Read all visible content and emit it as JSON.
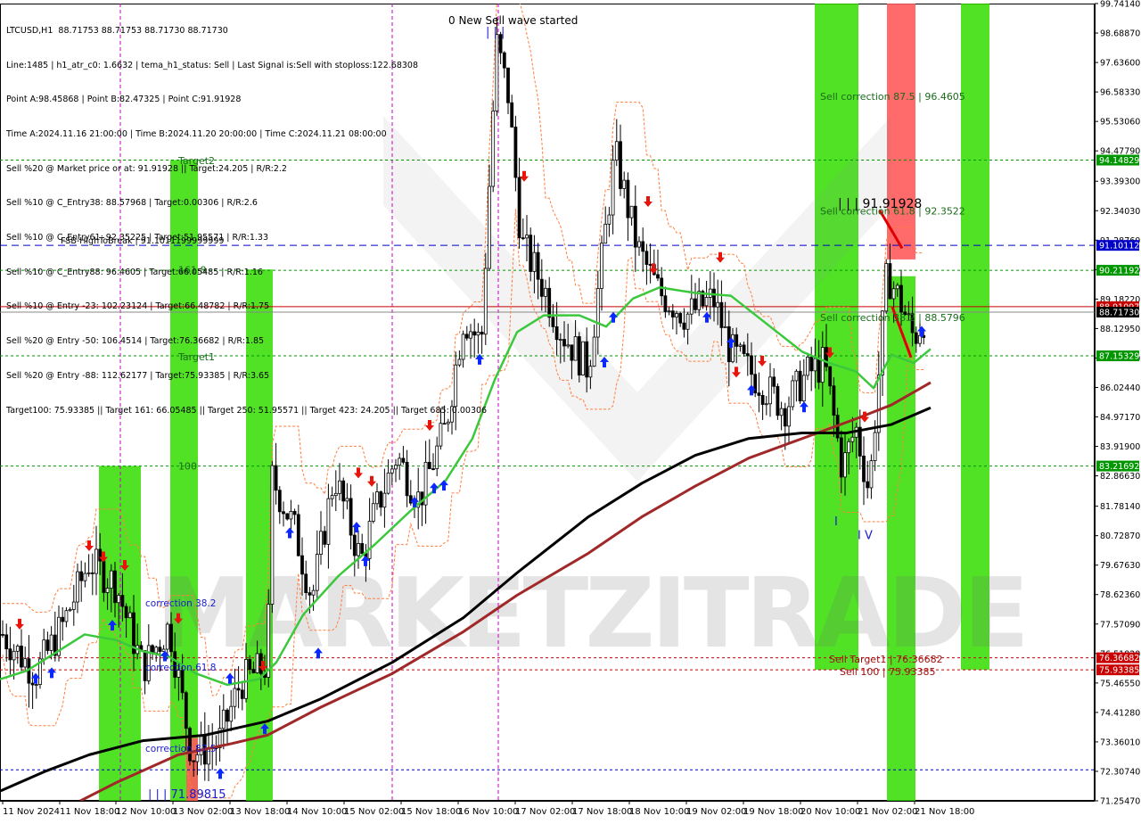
{
  "window_title": "LTCUSD,H1  88.71753 88.71753 88.71730 88.71730",
  "info_lines": [
    "Line:1485 | h1_atr_c0: 1.6632 | tema_h1_status: Sell | Last Signal is:Sell with stoploss:122.68308",
    "Point A:98.45868 | Point B:82.47325 | Point C:91.91928",
    "Time A:2024.11.16 21:00:00 | Time B:2024.11.20 20:00:00 | Time C:2024.11.21 08:00:00",
    "Sell %20 @ Market price or at: 91.91928 || Target:24.205 | R/R:2.2",
    "Sell %10 @ C_Entry38: 88.57968 | Target:0.00306 | R/R:2.6",
    "Sell %10 @ C_Entry61: 92.35225 | Target:51.95571 | R/R:1.33",
    "Sell %10 @ C_Entry88: 96.4605 | Target:66.05485 | R/R:1.16",
    "Sell %10 @ Entry -23: 102.23124 | Target:66.48782 | R/R:1.75",
    "Sell %20 @ Entry -50: 106.4514 | Target:76.36682 | R/R:1.85",
    "Sell %20 @ Entry -88: 112.62177 | Target:75.93385 | R/R:3.65",
    "Target100: 75.93385 || Target 161: 66.05485 || Target 250: 51.95571 || Target 423: 24.205 || Target 685: 0.00306"
  ],
  "top_message": "0 New Sell wave started",
  "watermark": "MARKETZITRADE",
  "colors": {
    "background": "#ffffff",
    "bull_candle": "#000000",
    "bear_candle": "#000000",
    "sma_fast": "#3cc83c",
    "sma_mid": "#a02828",
    "sma_slow": "#000000",
    "green_zone": "#33dd00",
    "red_zone": "#ff5a5a",
    "buy_arrow": "#0a28ff",
    "sell_arrow": "#e6140a",
    "level_green": "#009600",
    "level_blue": "#0000c8",
    "level_red": "#c80000",
    "envelope": "#ff7f3f",
    "zone_label": "#0a4a0a"
  },
  "chart_data": {
    "type": "candlestick",
    "symbol": "LTCUSD",
    "timeframe": "H1",
    "ylim": [
      71.2547,
      99.7414
    ],
    "y_ticks": [
      "99.74140",
      "98.68870",
      "97.63600",
      "96.58330",
      "95.53060",
      "94.47790",
      "93.39300",
      "92.34030",
      "91.28760",
      "90.23490",
      "89.18220",
      "88.12950",
      "87.07680",
      "86.02440",
      "84.97170",
      "83.91900",
      "82.86630",
      "81.78140",
      "80.72870",
      "79.67630",
      "78.62360",
      "77.57090",
      "76.51820",
      "75.46550",
      "74.41280",
      "73.36010",
      "72.30740",
      "71.25470"
    ],
    "x_ticks": [
      "11 Nov 2024",
      "11 Nov 18:00",
      "12 Nov 10:00",
      "13 Nov 02:00",
      "13 Nov 18:00",
      "14 Nov 10:00",
      "15 Nov 02:00",
      "15 Nov 18:00",
      "16 Nov 10:00",
      "17 Nov 02:00",
      "17 Nov 18:00",
      "18 Nov 10:00",
      "19 Nov 02:00",
      "19 Nov 18:00",
      "20 Nov 10:00",
      "21 Nov 02:00",
      "21 Nov 18:00"
    ],
    "price_badges": [
      {
        "label": "94.14829",
        "value": 94.14829,
        "color": "#009600"
      },
      {
        "label": "91.10112",
        "value": 91.10112,
        "color": "#0000c8"
      },
      {
        "label": "90.21192",
        "value": 90.21192,
        "color": "#009600"
      },
      {
        "label": "88.91097",
        "value": 88.91097,
        "color": "#c80000"
      },
      {
        "label": "88.71730",
        "value": 88.7173,
        "color": "#000000"
      },
      {
        "label": "87.15329",
        "value": 87.15329,
        "color": "#009600"
      },
      {
        "label": "83.21692",
        "value": 83.21692,
        "color": "#009600"
      },
      {
        "label": "76.36682",
        "value": 76.36682,
        "color": "#c80000"
      },
      {
        "label": "75.93385",
        "value": 75.93385,
        "color": "#c80000"
      }
    ],
    "levels": [
      {
        "value": 94.14829,
        "style": "dotted",
        "color": "#009600"
      },
      {
        "value": 91.10112,
        "style": "dashed",
        "color": "#0000c8",
        "label": "FSB-HighToBreak | 91.1011199999999"
      },
      {
        "value": 90.21192,
        "style": "dotted",
        "color": "#009600"
      },
      {
        "value": 88.91097,
        "style": "solid",
        "color": "#c80000"
      },
      {
        "value": 88.7173,
        "style": "solid",
        "color": "#888888"
      },
      {
        "value": 87.15329,
        "style": "dotted",
        "color": "#009600"
      },
      {
        "value": 83.21692,
        "style": "dotted",
        "color": "#009600"
      },
      {
        "value": 76.36682,
        "style": "dotted",
        "color": "#c80000"
      },
      {
        "value": 75.93385,
        "style": "dotted",
        "color": "#c80000"
      },
      {
        "value": 72.36,
        "style": "dotted",
        "color": "#0000c8"
      }
    ],
    "zone_labels": [
      {
        "text": "Target2",
        "value": 94.0,
        "bar": 200
      },
      {
        "text": "161.8",
        "value": 90.1,
        "bar": 200
      },
      {
        "text": "Target1",
        "value": 87.0,
        "bar": 200
      },
      {
        "text": "100",
        "value": 83.1,
        "bar": 200
      },
      {
        "text": "Sell correction 87.5 | 96.4605",
        "value": 96.3,
        "bar": 920
      },
      {
        "text": "Sell correction 61.8 | 92.3522",
        "value": 92.2,
        "bar": 920
      },
      {
        "text": "Sell correction 38.2 | 88.5796",
        "value": 88.4,
        "bar": 920
      },
      {
        "text": "Sell Target1 | 76.36682",
        "value": 76.2,
        "bar": 930
      },
      {
        "text": "Sell 100 | 75.93385",
        "value": 75.75,
        "bar": 942
      }
    ],
    "blue_labels": [
      {
        "text": "correction 38.2",
        "value": 78.2,
        "bar": 163
      },
      {
        "text": "correction 61.8",
        "value": 75.9,
        "bar": 163
      },
      {
        "text": "correction 87.5",
        "value": 73.0,
        "bar": 163
      },
      {
        "text": "| | | 71.89815",
        "value": 71.35,
        "bar": 166
      }
    ],
    "wave_labels": [
      {
        "text": "| | |",
        "value": 98.6,
        "bar": 545
      },
      {
        "text": "| | | 91.91928",
        "value": 92.45,
        "bar": 940
      },
      {
        "text": "I V",
        "value": 80.6,
        "bar": 962
      },
      {
        "text": "I",
        "value": 81.1,
        "bar": 936
      }
    ],
    "green_zones": [
      {
        "x0": 111,
        "x1": 158,
        "top": 83.22,
        "bottom": 71.25
      },
      {
        "x0": 191,
        "x1": 222,
        "top": 94.15,
        "bottom": 71.25
      },
      {
        "x0": 276,
        "x1": 306,
        "top": 90.24,
        "bottom": 71.25
      },
      {
        "x0": 914,
        "x1": 963,
        "top": 99.74,
        "bottom": 75.94
      },
      {
        "x0": 995,
        "x1": 1027,
        "top": 90.0,
        "bottom": 71.25
      },
      {
        "x0": 1078,
        "x1": 1110,
        "top": 99.74,
        "bottom": 75.94
      }
    ],
    "red_zones": [
      {
        "x0": 209,
        "x1": 222,
        "top": 73.5,
        "bottom": 71.25
      },
      {
        "x0": 995,
        "x1": 1027,
        "top": 99.74,
        "bottom": 90.6
      }
    ],
    "vlines": [
      135,
      440,
      559
    ],
    "anchor_points": [
      {
        "x": 3,
        "y": 77.2
      },
      {
        "x": 40,
        "y": 75.8
      },
      {
        "x": 70,
        "y": 77.5
      },
      {
        "x": 100,
        "y": 79.8
      },
      {
        "x": 130,
        "y": 79.0
      },
      {
        "x": 160,
        "y": 76.0
      },
      {
        "x": 190,
        "y": 77.5
      },
      {
        "x": 215,
        "y": 72.9
      },
      {
        "x": 245,
        "y": 73.3
      },
      {
        "x": 270,
        "y": 75.5
      },
      {
        "x": 300,
        "y": 76.1
      },
      {
        "x": 305,
        "y": 82.8
      },
      {
        "x": 330,
        "y": 81.0
      },
      {
        "x": 350,
        "y": 78.5
      },
      {
        "x": 375,
        "y": 82.9
      },
      {
        "x": 405,
        "y": 79.8
      },
      {
        "x": 420,
        "y": 81.5
      },
      {
        "x": 445,
        "y": 83.6
      },
      {
        "x": 470,
        "y": 82.0
      },
      {
        "x": 500,
        "y": 84.6
      },
      {
        "x": 520,
        "y": 88.5
      },
      {
        "x": 540,
        "y": 87.6
      },
      {
        "x": 557,
        "y": 98.3
      },
      {
        "x": 570,
        "y": 96.5
      },
      {
        "x": 585,
        "y": 91.2
      },
      {
        "x": 610,
        "y": 89.6
      },
      {
        "x": 630,
        "y": 88.0
      },
      {
        "x": 660,
        "y": 86.7
      },
      {
        "x": 690,
        "y": 94.4
      },
      {
        "x": 715,
        "y": 91.0
      },
      {
        "x": 740,
        "y": 89.4
      },
      {
        "x": 770,
        "y": 88.6
      },
      {
        "x": 800,
        "y": 89.2
      },
      {
        "x": 820,
        "y": 87.3
      },
      {
        "x": 850,
        "y": 86.3
      },
      {
        "x": 880,
        "y": 85.3
      },
      {
        "x": 905,
        "y": 86.5
      },
      {
        "x": 925,
        "y": 86.9
      },
      {
        "x": 945,
        "y": 83.1
      },
      {
        "x": 960,
        "y": 84.6
      },
      {
        "x": 975,
        "y": 82.3
      },
      {
        "x": 995,
        "y": 90.1
      },
      {
        "x": 1010,
        "y": 89.1
      },
      {
        "x": 1025,
        "y": 87.8
      },
      {
        "x": 1040,
        "y": 88.7
      }
    ],
    "ma_fast": [
      {
        "x": 0,
        "y": 75.6
      },
      {
        "x": 30,
        "y": 75.9
      },
      {
        "x": 60,
        "y": 76.5
      },
      {
        "x": 95,
        "y": 77.2
      },
      {
        "x": 130,
        "y": 77.0
      },
      {
        "x": 160,
        "y": 76.6
      },
      {
        "x": 190,
        "y": 76.4
      },
      {
        "x": 220,
        "y": 75.8
      },
      {
        "x": 255,
        "y": 75.4
      },
      {
        "x": 290,
        "y": 75.6
      },
      {
        "x": 310,
        "y": 76.2
      },
      {
        "x": 340,
        "y": 77.9
      },
      {
        "x": 380,
        "y": 79.3
      },
      {
        "x": 420,
        "y": 80.4
      },
      {
        "x": 460,
        "y": 81.6
      },
      {
        "x": 500,
        "y": 82.7
      },
      {
        "x": 530,
        "y": 84.2
      },
      {
        "x": 555,
        "y": 86.3
      },
      {
        "x": 580,
        "y": 88.0
      },
      {
        "x": 610,
        "y": 88.6
      },
      {
        "x": 650,
        "y": 88.6
      },
      {
        "x": 680,
        "y": 88.2
      },
      {
        "x": 710,
        "y": 89.2
      },
      {
        "x": 740,
        "y": 89.6
      },
      {
        "x": 780,
        "y": 89.4
      },
      {
        "x": 820,
        "y": 89.3
      },
      {
        "x": 860,
        "y": 88.3
      },
      {
        "x": 900,
        "y": 87.3
      },
      {
        "x": 930,
        "y": 86.9
      },
      {
        "x": 960,
        "y": 86.6
      },
      {
        "x": 980,
        "y": 86.0
      },
      {
        "x": 1000,
        "y": 87.2
      },
      {
        "x": 1025,
        "y": 86.9
      },
      {
        "x": 1044,
        "y": 87.4
      }
    ],
    "ma_mid": [
      {
        "x": 90,
        "y": 71.25
      },
      {
        "x": 130,
        "y": 71.9
      },
      {
        "x": 200,
        "y": 72.9
      },
      {
        "x": 260,
        "y": 73.3
      },
      {
        "x": 300,
        "y": 73.6
      },
      {
        "x": 360,
        "y": 74.6
      },
      {
        "x": 440,
        "y": 75.8
      },
      {
        "x": 520,
        "y": 77.3
      },
      {
        "x": 580,
        "y": 78.6
      },
      {
        "x": 660,
        "y": 80.1
      },
      {
        "x": 720,
        "y": 81.4
      },
      {
        "x": 780,
        "y": 82.5
      },
      {
        "x": 840,
        "y": 83.5
      },
      {
        "x": 900,
        "y": 84.2
      },
      {
        "x": 960,
        "y": 84.9
      },
      {
        "x": 1000,
        "y": 85.4
      },
      {
        "x": 1044,
        "y": 86.2
      }
    ],
    "ma_slow": [
      {
        "x": 0,
        "y": 71.6
      },
      {
        "x": 50,
        "y": 72.3
      },
      {
        "x": 100,
        "y": 72.9
      },
      {
        "x": 160,
        "y": 73.4
      },
      {
        "x": 230,
        "y": 73.6
      },
      {
        "x": 300,
        "y": 74.1
      },
      {
        "x": 360,
        "y": 74.9
      },
      {
        "x": 440,
        "y": 76.2
      },
      {
        "x": 520,
        "y": 77.8
      },
      {
        "x": 580,
        "y": 79.4
      },
      {
        "x": 660,
        "y": 81.4
      },
      {
        "x": 720,
        "y": 82.6
      },
      {
        "x": 780,
        "y": 83.6
      },
      {
        "x": 840,
        "y": 84.2
      },
      {
        "x": 900,
        "y": 84.4
      },
      {
        "x": 950,
        "y": 84.4
      },
      {
        "x": 1000,
        "y": 84.7
      },
      {
        "x": 1044,
        "y": 85.3
      }
    ],
    "buy_arrows": [
      {
        "x": 40,
        "y": 75.6
      },
      {
        "x": 58,
        "y": 75.8
      },
      {
        "x": 126,
        "y": 77.5
      },
      {
        "x": 185,
        "y": 76.4
      },
      {
        "x": 247,
        "y": 72.2
      },
      {
        "x": 258,
        "y": 75.6
      },
      {
        "x": 297,
        "y": 73.8
      },
      {
        "x": 325,
        "y": 80.8
      },
      {
        "x": 357,
        "y": 76.5
      },
      {
        "x": 400,
        "y": 81.0
      },
      {
        "x": 410,
        "y": 79.8
      },
      {
        "x": 465,
        "y": 81.9
      },
      {
        "x": 487,
        "y": 82.4
      },
      {
        "x": 498,
        "y": 82.5
      },
      {
        "x": 538,
        "y": 87.0
      },
      {
        "x": 678,
        "y": 86.9
      },
      {
        "x": 688,
        "y": 88.5
      },
      {
        "x": 793,
        "y": 88.5
      },
      {
        "x": 820,
        "y": 87.6
      },
      {
        "x": 843,
        "y": 85.9
      },
      {
        "x": 902,
        "y": 85.3
      },
      {
        "x": 1034,
        "y": 88.0
      }
    ],
    "sell_arrows": [
      {
        "x": 22,
        "y": 77.6
      },
      {
        "x": 100,
        "y": 80.4
      },
      {
        "x": 116,
        "y": 80.0
      },
      {
        "x": 140,
        "y": 79.7
      },
      {
        "x": 200,
        "y": 77.8
      },
      {
        "x": 295,
        "y": 76.1
      },
      {
        "x": 402,
        "y": 83.0
      },
      {
        "x": 417,
        "y": 82.7
      },
      {
        "x": 482,
        "y": 84.7
      },
      {
        "x": 588,
        "y": 93.6
      },
      {
        "x": 727,
        "y": 92.7
      },
      {
        "x": 733,
        "y": 90.3
      },
      {
        "x": 808,
        "y": 90.7
      },
      {
        "x": 826,
        "y": 86.6
      },
      {
        "x": 855,
        "y": 87.0
      },
      {
        "x": 931,
        "y": 87.3
      },
      {
        "x": 970,
        "y": 85.0
      }
    ]
  }
}
